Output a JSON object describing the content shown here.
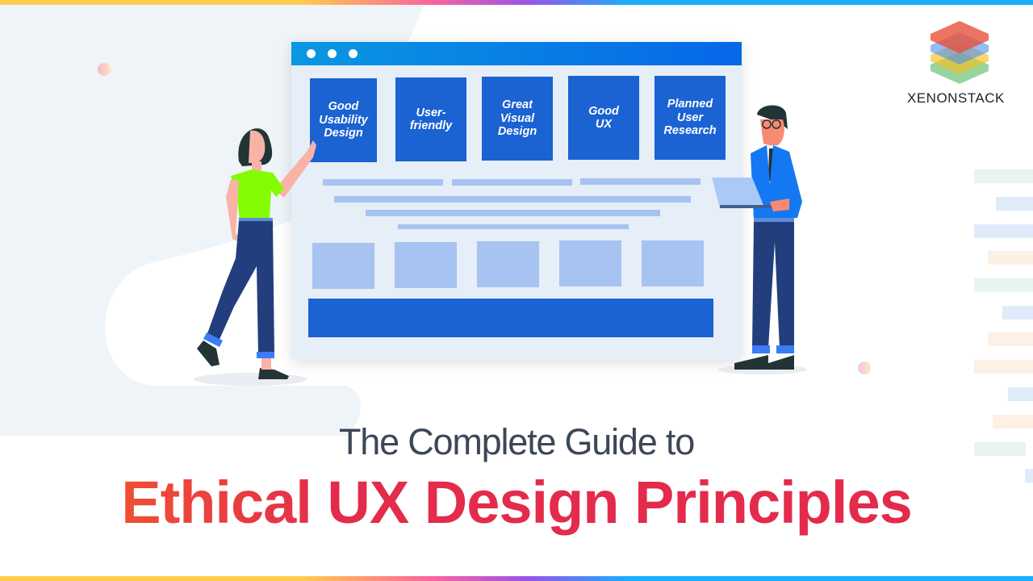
{
  "brand": {
    "name": "XENONSTACK",
    "logo_layers": [
      "#e8513a",
      "#4b8ef0",
      "#f5c024",
      "#44b04c"
    ]
  },
  "colors": {
    "title_red": "#e32b4c",
    "subtitle_gray": "#3d4659",
    "card_blue": "#1b62d3",
    "accent_line": "#a6c3f1"
  },
  "illustration": {
    "window_controls": [
      "dot",
      "dot",
      "dot"
    ],
    "cards": [
      {
        "lines": [
          "Good",
          "Usability",
          "Design"
        ]
      },
      {
        "lines": [
          "User-",
          "friendly"
        ]
      },
      {
        "lines": [
          "Great",
          "Visual",
          "Design"
        ]
      },
      {
        "lines": [
          "Good",
          "UX"
        ]
      },
      {
        "lines": [
          "Planned",
          "User",
          "Research"
        ]
      }
    ],
    "characters": [
      "woman-pointing",
      "man-with-laptop"
    ]
  },
  "heading": {
    "subtitle": "The Complete Guide to",
    "title_first_word": "Ethical",
    "title_rest": " UX Design Principles"
  }
}
